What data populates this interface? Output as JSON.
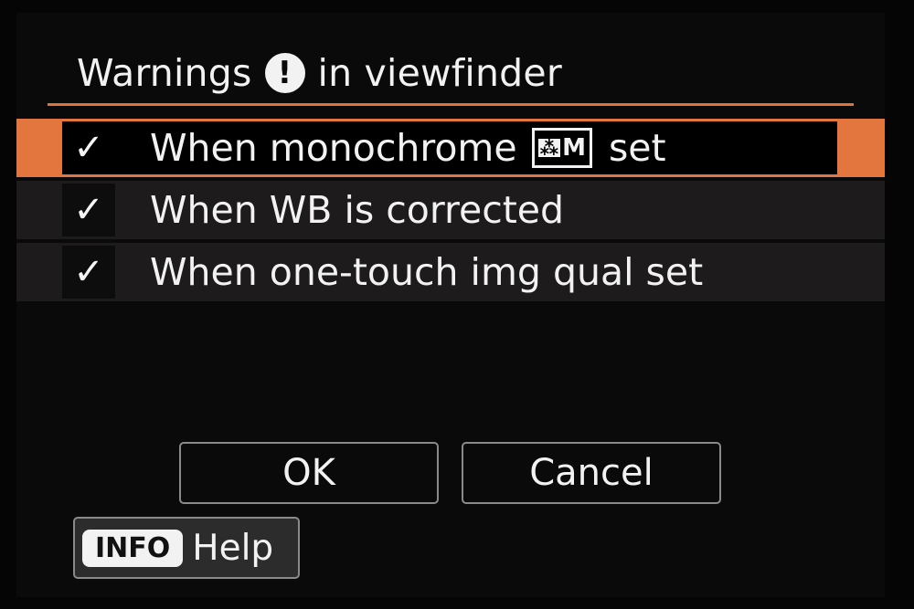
{
  "header": {
    "title_before": "Warnings",
    "title_icon": "exclamation-icon",
    "title_icon_glyph": "!",
    "title_after": "in viewfinder"
  },
  "options": [
    {
      "label_before": "When monochrome",
      "icon": "monochrome-picture-style-icon",
      "icon_glyph": "⁂",
      "icon_text": "M",
      "label_after": "set",
      "checked": true,
      "check_glyph": "✓",
      "selected": true
    },
    {
      "label": "When WB is corrected",
      "checked": true,
      "check_glyph": "✓",
      "selected": false
    },
    {
      "label": "When one-touch img qual set",
      "checked": true,
      "check_glyph": "✓",
      "selected": false
    }
  ],
  "buttons": {
    "ok_label": "OK",
    "cancel_label": "Cancel"
  },
  "help": {
    "info_label": "INFO",
    "help_label": "Help"
  },
  "colors": {
    "accent": "#e2763e",
    "row_bg": "#1d1b1c",
    "background": "#0a0a0a",
    "text": "#f2f2f2"
  }
}
